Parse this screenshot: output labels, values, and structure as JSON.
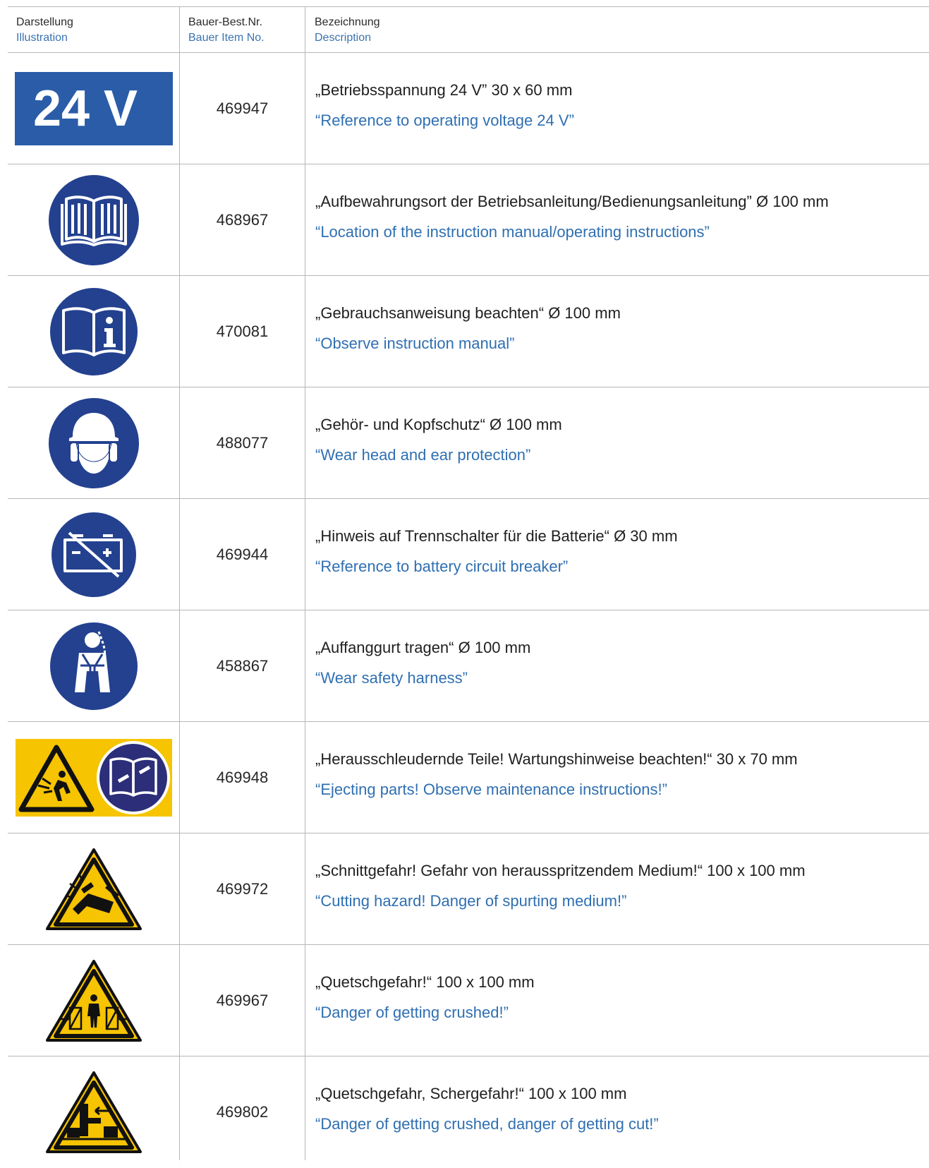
{
  "header": {
    "col1_de": "Darstellung",
    "col1_en": "Illustration",
    "col2_de": "Bauer-Best.Nr.",
    "col2_en": "Bauer Item No.",
    "col3_de": "Bezeichnung",
    "col3_en": "Description"
  },
  "rows": [
    {
      "icon": "24v-voltage-sign",
      "sign_text": "24 V",
      "item_no": "469947",
      "desc_de": "„Betriebsspannung 24 V” 30 x 60 mm",
      "desc_en": "“Reference to operating voltage 24 V”"
    },
    {
      "icon": "manual-book-icon",
      "item_no": "468967",
      "desc_de": "„Aufbewahrungsort der Betriebsanleitung/Bedienungsanleitung” Ø 100 mm",
      "desc_en": "“Location of the instruction manual/operating instructions”"
    },
    {
      "icon": "manual-info-icon",
      "item_no": "470081",
      "desc_de": "„Gebrauchsanweisung beachten“ Ø 100 mm",
      "desc_en": "“Observe instruction manual”"
    },
    {
      "icon": "head-ear-protection-icon",
      "item_no": "488077",
      "desc_de": "„Gehör- und Kopfschutz“ Ø 100 mm",
      "desc_en": "“Wear head and ear protection”"
    },
    {
      "icon": "battery-disconnect-icon",
      "item_no": "469944",
      "desc_de": "„Hinweis auf Trennschalter für die Batterie“ Ø 30 mm",
      "desc_en": "“Reference to battery circuit breaker”"
    },
    {
      "icon": "safety-harness-icon",
      "item_no": "458867",
      "desc_de": "„Auffanggurt tragen“ Ø 100 mm",
      "desc_en": "“Wear safety harness”"
    },
    {
      "icon": "ejecting-parts-maintenance-icon",
      "item_no": "469948",
      "desc_de": "„Herausschleudernde Teile! Wartungshinweise beachten!“ 30 x 70 mm",
      "desc_en": "“Ejecting parts! Observe maintenance instructions!”"
    },
    {
      "icon": "cutting-hazard-icon",
      "item_no": "469972",
      "desc_de": "„Schnittgefahr! Gefahr von herausspritzendem Medium!“ 100 x 100 mm",
      "desc_en": "“Cutting hazard! Danger of spurting medium!”"
    },
    {
      "icon": "crushing-hazard-icon",
      "item_no": "469967",
      "desc_de": "„Quetschgefahr!“ 100 x 100 mm",
      "desc_en": "“Danger of getting crushed!”"
    },
    {
      "icon": "crush-shear-hazard-icon",
      "item_no": "469802",
      "desc_de": "„Quetschgefahr, Schergefahr!“ 100 x 100 mm",
      "desc_en": "“Danger of getting crushed, danger of getting cut!”"
    }
  ],
  "colors": {
    "blue_sign": "#2a5ca8",
    "circle_blue": "#24418f",
    "warning_yellow": "#f6c400",
    "english_text": "#2f6fb1",
    "grid_line": "#b7b7b7"
  }
}
